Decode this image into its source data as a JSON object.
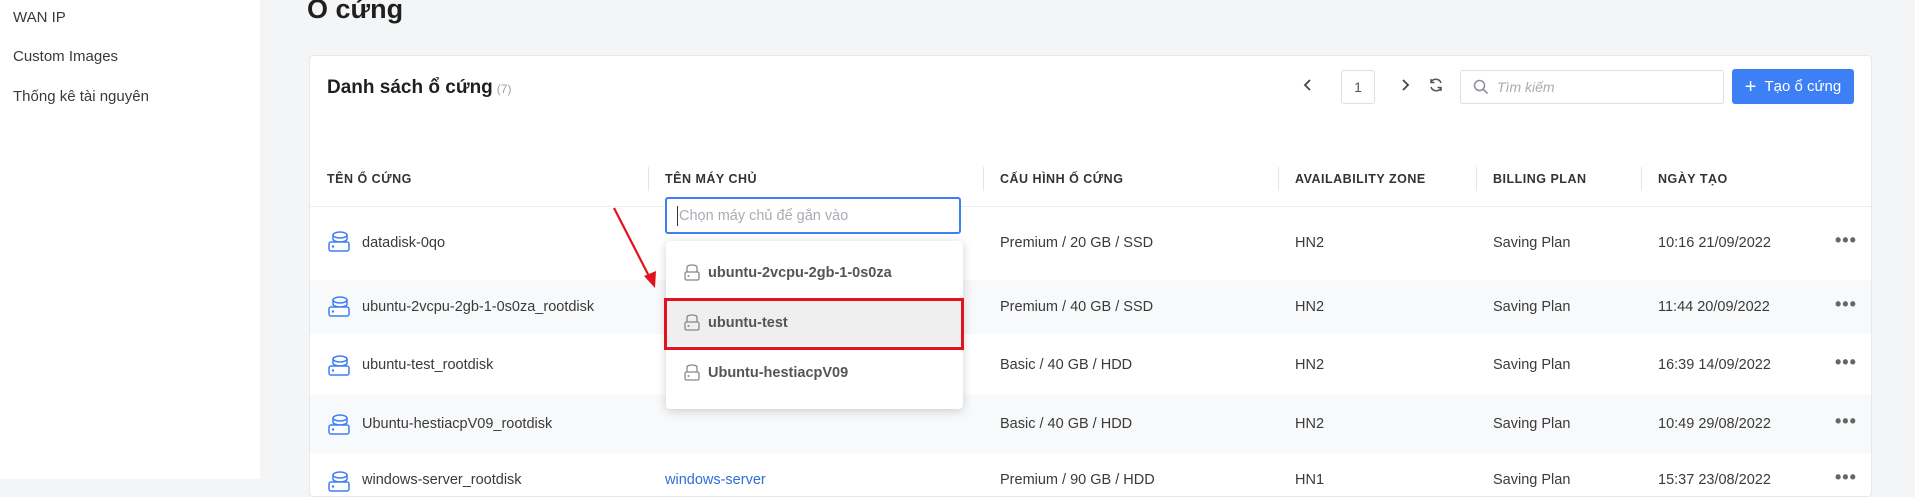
{
  "sidebar": {
    "items": [
      {
        "label": "WAN IP"
      },
      {
        "label": "Custom Images"
      },
      {
        "label": "Thống kê tài nguyên"
      }
    ]
  },
  "page": {
    "title": "Ổ cứng"
  },
  "card": {
    "title": "Danh sách ổ cứng",
    "count": "(7)",
    "pagination": {
      "current": "1"
    },
    "search": {
      "placeholder": "Tìm kiếm"
    },
    "create_label": "Tạo ổ cứng"
  },
  "table": {
    "columns": [
      "TÊN Ổ CỨNG",
      "TÊN MÁY CHỦ",
      "CẤU HÌNH Ổ CỨNG",
      "AVAILABILITY ZONE",
      "BILLING PLAN",
      "NGÀY TẠO"
    ],
    "rows": [
      {
        "name": "datadisk-0qo",
        "server": "",
        "config": "Premium / 20 GB / SSD",
        "zone": "HN2",
        "plan": "Saving Plan",
        "created": "10:16 21/09/2022"
      },
      {
        "name": "ubuntu-2vcpu-2gb-1-0s0za_rootdisk",
        "server": "",
        "config": "Premium / 40 GB / SSD",
        "zone": "HN2",
        "plan": "Saving Plan",
        "created": "11:44 20/09/2022"
      },
      {
        "name": "ubuntu-test_rootdisk",
        "server": "",
        "config": "Basic / 40 GB / HDD",
        "zone": "HN2",
        "plan": "Saving Plan",
        "created": "16:39 14/09/2022"
      },
      {
        "name": "Ubuntu-hestiacpV09_rootdisk",
        "server": "",
        "config": "Basic / 40 GB / HDD",
        "zone": "HN2",
        "plan": "Saving Plan",
        "created": "10:49 29/08/2022"
      },
      {
        "name": "windows-server_rootdisk",
        "server": "windows-server",
        "config": "Premium / 90 GB / HDD",
        "zone": "HN1",
        "plan": "Saving Plan",
        "created": "15:37 23/08/2022"
      }
    ],
    "row_menu": "•••"
  },
  "server_select": {
    "placeholder": "Chọn máy chủ để gắn vào",
    "options": [
      {
        "label": "ubuntu-2vcpu-2gb-1-0s0za"
      },
      {
        "label": "ubuntu-test",
        "highlighted": true
      },
      {
        "label": "Ubuntu-hestiacpV09"
      }
    ]
  },
  "colors": {
    "accent": "#3d7ff5",
    "annotation": "#e0141c",
    "link": "#2f6fd8"
  },
  "icons": {
    "disk": "disk-stack-icon",
    "server": "server-icon",
    "search": "search-icon",
    "refresh": "refresh-icon"
  }
}
